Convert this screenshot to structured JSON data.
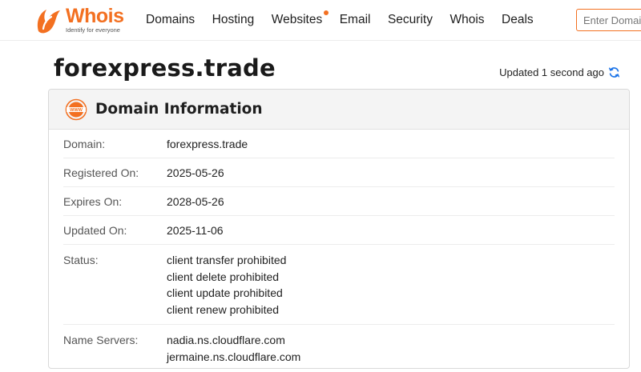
{
  "header": {
    "logo": {
      "word": "Whois",
      "tagline": "Identify for everyone"
    },
    "nav": [
      {
        "label": "Domains"
      },
      {
        "label": "Hosting"
      },
      {
        "label": "Websites",
        "dot": true
      },
      {
        "label": "Email"
      },
      {
        "label": "Security"
      },
      {
        "label": "Whois"
      },
      {
        "label": "Deals"
      }
    ],
    "search": {
      "placeholder": "Enter Domain"
    }
  },
  "page": {
    "title": "forexpress.trade",
    "updated": "Updated 1 second ago"
  },
  "card": {
    "title": "Domain Information",
    "icon": "www-icon",
    "rows": [
      {
        "label": "Domain:",
        "values": [
          "forexpress.trade"
        ]
      },
      {
        "label": "Registered On:",
        "values": [
          "2025-05-26"
        ]
      },
      {
        "label": "Expires On:",
        "values": [
          "2028-05-26"
        ]
      },
      {
        "label": "Updated On:",
        "values": [
          "2025-11-06"
        ]
      },
      {
        "label": "Status:",
        "values": [
          "client transfer prohibited",
          "client delete prohibited",
          "client update prohibited",
          "client renew prohibited"
        ]
      },
      {
        "label": "Name Servers:",
        "values": [
          "nadia.ns.cloudflare.com",
          "jermaine.ns.cloudflare.com"
        ]
      }
    ]
  },
  "colors": {
    "brand": "#f37021",
    "refresh": "#1a73e8"
  }
}
